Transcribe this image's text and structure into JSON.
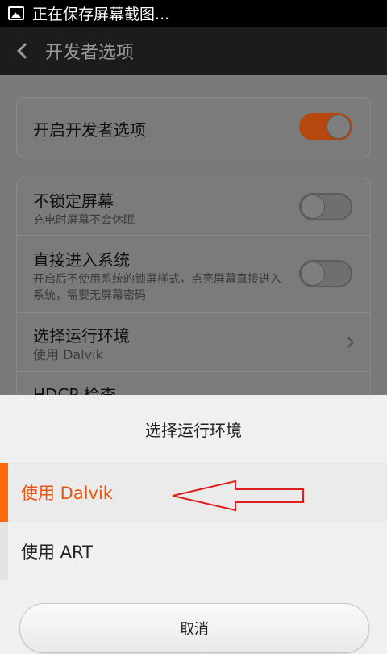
{
  "status_bar": {
    "text": "正在保存屏幕截图..."
  },
  "title_bar": {
    "title": "开发者选项"
  },
  "settings": {
    "developer_toggle": {
      "label": "开启开发者选项",
      "state": "on"
    },
    "items": [
      {
        "title": "不锁定屏幕",
        "subtitle": "充电时屏幕不会休眠",
        "toggle": "off"
      },
      {
        "title": "直接进入系统",
        "subtitle": "开启后不使用系统的锁屏样式，点亮屏幕直接进入系统，需要无屏幕密码",
        "toggle": "off"
      },
      {
        "title": "选择运行环境",
        "subtitle": "使用 Dalvik"
      },
      {
        "title": "HDCP 检查"
      }
    ]
  },
  "sheet": {
    "title": "选择运行环境",
    "options": [
      {
        "label": "使用 Dalvik",
        "selected": true
      },
      {
        "label": "使用 ART",
        "selected": false
      }
    ],
    "cancel_label": "取消"
  },
  "colors": {
    "accent": "#e8540c",
    "annotation": "#e0201c"
  }
}
